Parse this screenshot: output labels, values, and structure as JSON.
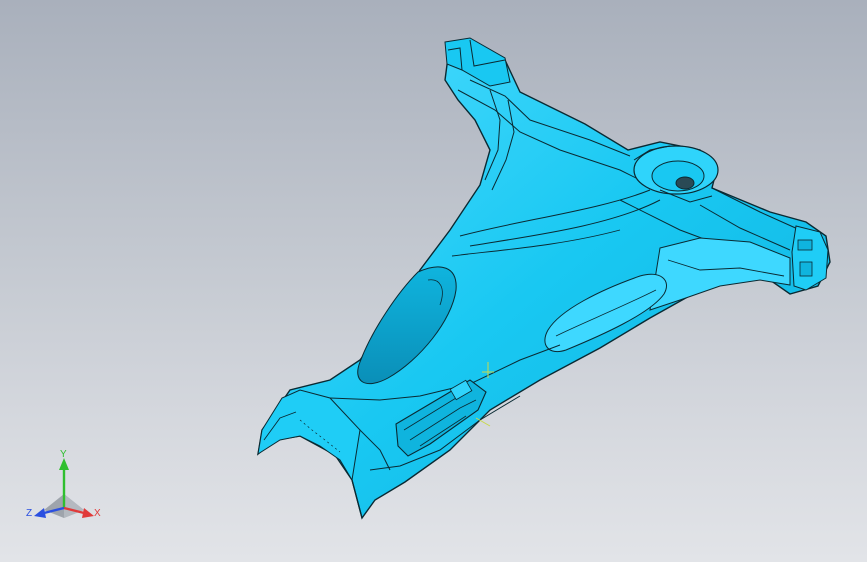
{
  "viewport": {
    "background_top": "#a9b0bc",
    "background_bottom": "#e2e4e8"
  },
  "model": {
    "fill_color": "#19c8f2",
    "edge_color": "#0a2a33",
    "highlight_color": "#8eeaff",
    "shadow_color": "#0a9cc4"
  },
  "triad": {
    "y_label": "Y",
    "z_label": "Z",
    "x_label": "X",
    "y_color": "#2fbf2f",
    "x_color": "#e03a3a",
    "z_color": "#2a4fe0"
  }
}
